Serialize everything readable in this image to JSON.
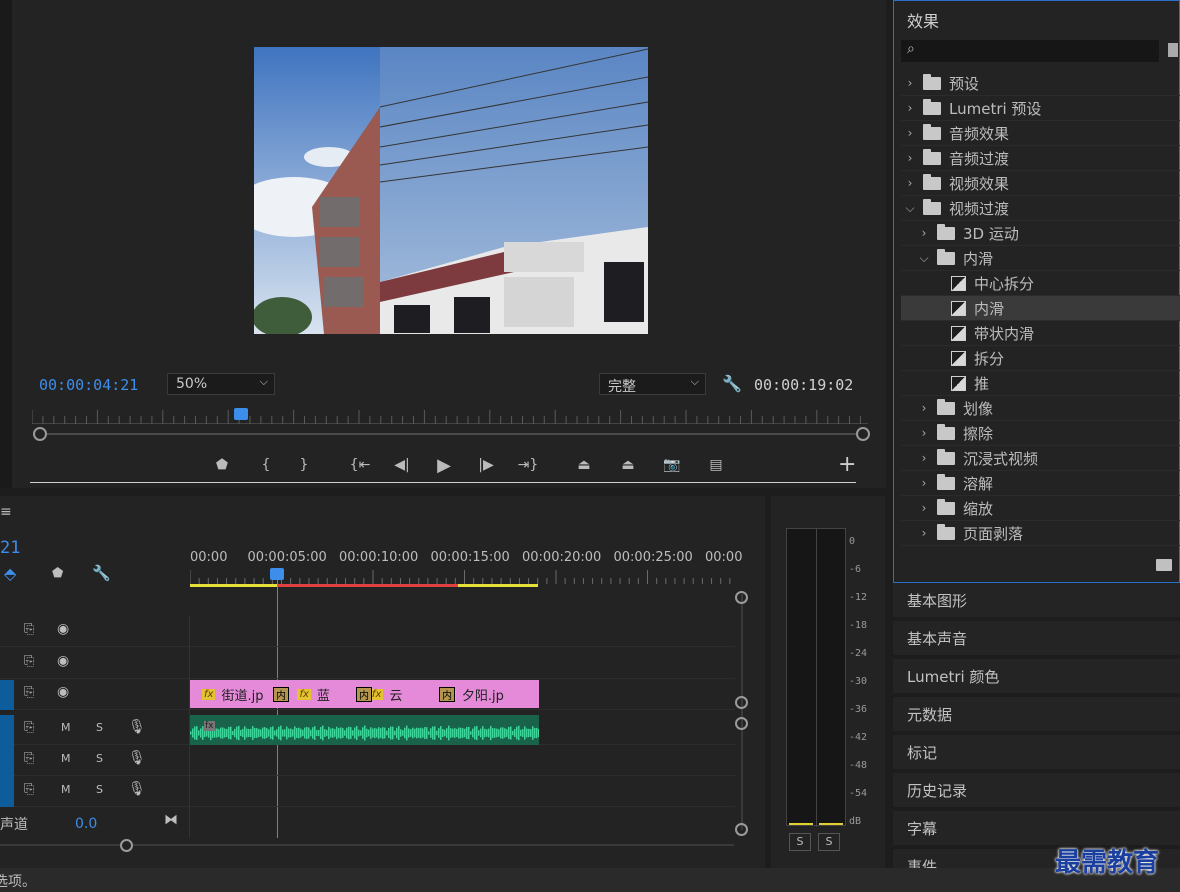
{
  "program": {
    "current_time": "00:00:04:21",
    "zoom": "50%",
    "quality": "完整",
    "duration": "00:00:19:02",
    "playhead_fraction": 0.25
  },
  "effects": {
    "title": "效果",
    "search_placeholder": "",
    "items": [
      {
        "label": "预设",
        "level": 0,
        "type": "preset-folder",
        "expanded": false
      },
      {
        "label": "Lumetri 预设",
        "level": 0,
        "type": "preset-folder",
        "expanded": false
      },
      {
        "label": "音频效果",
        "level": 0,
        "type": "folder",
        "expanded": false
      },
      {
        "label": "音频过渡",
        "level": 0,
        "type": "folder",
        "expanded": false
      },
      {
        "label": "视频效果",
        "level": 0,
        "type": "folder",
        "expanded": false
      },
      {
        "label": "视频过渡",
        "level": 0,
        "type": "folder",
        "expanded": true
      },
      {
        "label": "3D 运动",
        "level": 1,
        "type": "folder",
        "expanded": false
      },
      {
        "label": "内滑",
        "level": 1,
        "type": "folder",
        "expanded": true
      },
      {
        "label": "中心拆分",
        "level": 2,
        "type": "transition"
      },
      {
        "label": "内滑",
        "level": 2,
        "type": "transition",
        "selected": true
      },
      {
        "label": "带状内滑",
        "level": 2,
        "type": "transition"
      },
      {
        "label": "拆分",
        "level": 2,
        "type": "transition"
      },
      {
        "label": "推",
        "level": 2,
        "type": "transition"
      },
      {
        "label": "划像",
        "level": 1,
        "type": "folder",
        "expanded": false
      },
      {
        "label": "擦除",
        "level": 1,
        "type": "folder",
        "expanded": false
      },
      {
        "label": "沉浸式视频",
        "level": 1,
        "type": "folder",
        "expanded": false
      },
      {
        "label": "溶解",
        "level": 1,
        "type": "folder",
        "expanded": false
      },
      {
        "label": "缩放",
        "level": 1,
        "type": "folder",
        "expanded": false
      },
      {
        "label": "页面剥落",
        "level": 1,
        "type": "folder",
        "expanded": false
      }
    ]
  },
  "panels": [
    "基本图形",
    "基本声音",
    "Lumetri 颜色",
    "元数据",
    "标记",
    "历史记录",
    "字幕",
    "事件"
  ],
  "timeline": {
    "timecode": "21",
    "ruler": [
      "00:00",
      "00:00:05:00",
      "00:00:10:00",
      "00:00:15:00",
      "00:00:20:00",
      "00:00:25:00",
      "00:00"
    ],
    "clips": [
      {
        "label": "街道.jp"
      },
      {
        "label": "蓝"
      },
      {
        "label": "云"
      },
      {
        "label": "夕阳.jp"
      }
    ],
    "transition_label": "内",
    "audio_fx": "fx",
    "audio_buttons": {
      "m": "M",
      "s": "S"
    },
    "master_label": "声道",
    "master_value": "0.0"
  },
  "meter": {
    "scale": [
      "0",
      "-6",
      "-12",
      "-18",
      "-24",
      "-30",
      "-36",
      "-42",
      "-48",
      "-54",
      "dB"
    ],
    "solo": [
      "S",
      "S"
    ]
  },
  "status": {
    "text": "选项。"
  },
  "watermark": "最需教育",
  "colors": {
    "accent": "#3d8eea",
    "clip": "#e48ad9",
    "audio": "#2fae7b"
  }
}
